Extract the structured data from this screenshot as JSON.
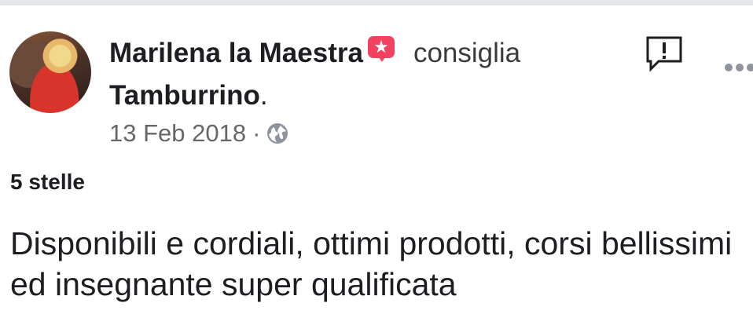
{
  "post": {
    "author": "Marilena la Maestra",
    "verb": "consiglia",
    "page": "Tamburrino",
    "period": ".",
    "date": "13 Feb 2018",
    "separator": "·",
    "rating": "5 stelle",
    "review_text": "Disponibili e cordiali, ottimi prodotti, corsi bellissimi ed insegnante super qualificata"
  },
  "icons": {
    "recommend": "recommend-star-bubble-icon",
    "audience": "globe-icon",
    "report": "report-icon",
    "more": "more-options-icon",
    "star_glyph": "★"
  },
  "colors": {
    "recommend_accent": "#f3425f",
    "meta_text": "#65676b",
    "primary_text": "#1c1e21"
  }
}
